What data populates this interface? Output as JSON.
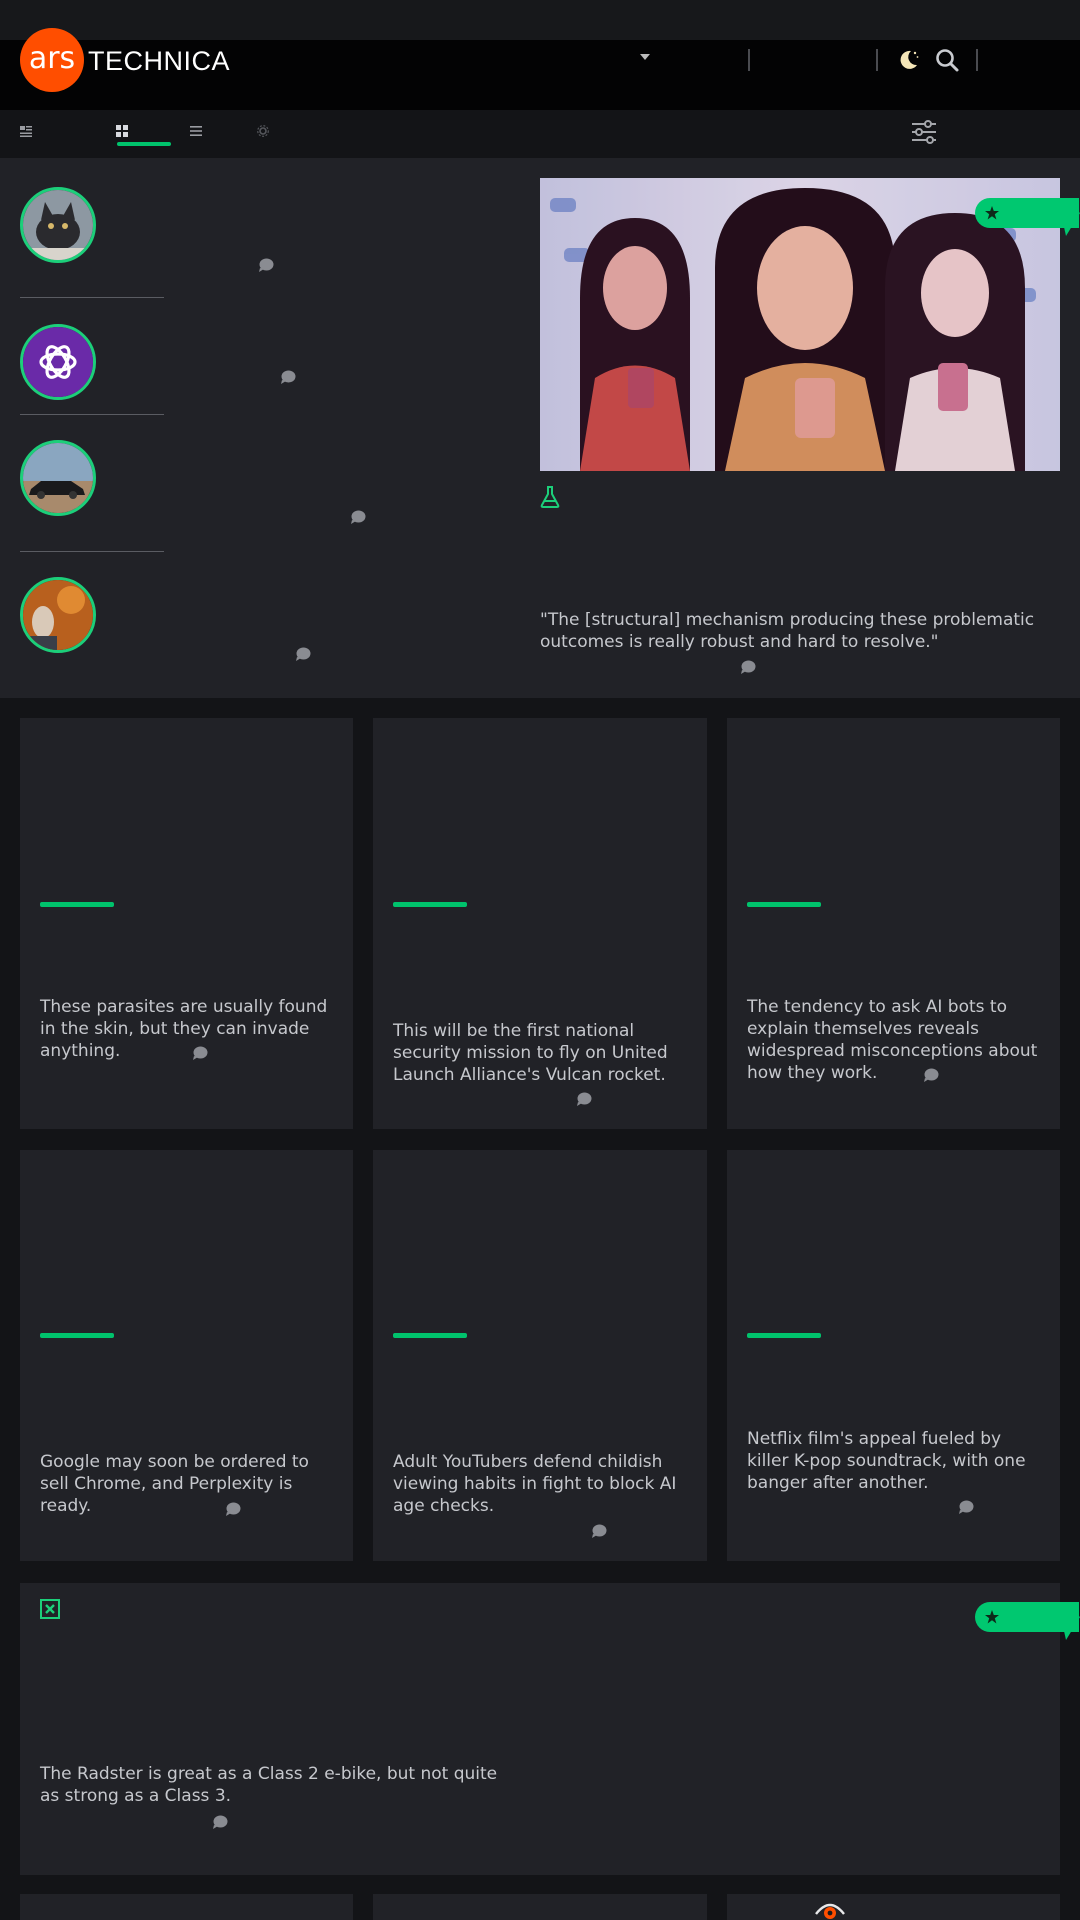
{
  "header": {
    "logo_ars": "ars",
    "logo_technica": "TECHNICA",
    "icons": [
      "dropdown-caret-icon",
      "moon-icon",
      "search-icon"
    ]
  },
  "toolbar": {
    "icons": [
      "view-classic-icon",
      "view-grid-icon",
      "view-list-icon",
      "view-settings-icon",
      "filter-sliders-icon"
    ],
    "active_view": "grid"
  },
  "featured": {
    "avatars": [
      "cat-avatar",
      "openai-logo-avatar",
      "car-avatar",
      "person-avatar"
    ],
    "hero_quote": "\"The [structural] mechanism producing these problematic outcomes is really robust and hard to resolve.\""
  },
  "cards": [
    {
      "text": "These parasites are usually found in the skin, but they can invade anything."
    },
    {
      "text": "This will be the first national security mission to fly on United Launch Alliance's Vulcan rocket."
    },
    {
      "text": "The tendency to ask AI bots to explain themselves reveals widespread misconceptions about how they work."
    },
    {
      "text": "Google may soon be ordered to sell Chrome, and Perplexity is ready."
    },
    {
      "text": "Adult YouTubers defend childish viewing habits in fight to block AI age checks."
    },
    {
      "text": "Netflix film's appeal fueled by killer K-pop soundtrack, with one banger after another."
    }
  ],
  "wide_card": {
    "text": "The Radster is great as a Class 2 e-bike, but not quite as strong as a Class 3."
  },
  "colors": {
    "accent_green": "#00c36c",
    "brand_orange": "#ff4e00",
    "card_bg": "#212227",
    "page_bg": "#131417"
  }
}
